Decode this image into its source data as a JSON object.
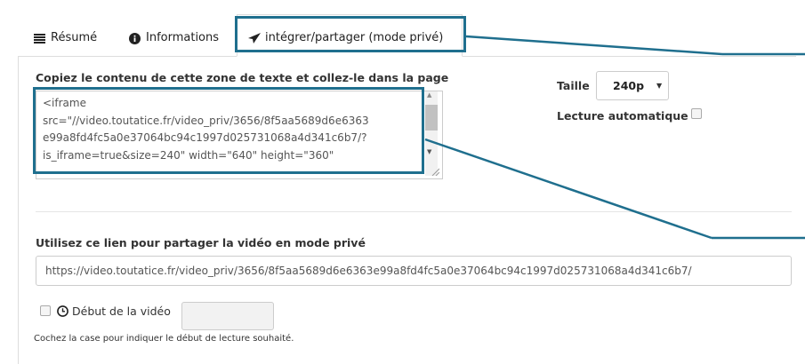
{
  "tabs": {
    "resume": "Résumé",
    "informations": "Informations",
    "share": "intégrer/partager (mode privé)"
  },
  "embed": {
    "label": "Copiez le contenu de cette zone de texte et collez-le dans la page",
    "code_lines": [
      "<iframe",
      "src=\"//video.toutatice.fr/video_priv/3656/8f5aa5689d6e6363",
      "e99a8fd4fc5a0e37064bc94c1997d025731068a4d341c6b7/?",
      "is_iframe=true&size=240\" width=\"640\" height=\"360\""
    ]
  },
  "options": {
    "size_label": "Taille",
    "size_value": "240p",
    "autoplay_label": "Lecture automatique",
    "autoplay_checked": false
  },
  "share": {
    "label": "Utilisez ce lien pour partager la vidéo en mode privé",
    "link": "https://video.toutatice.fr/video_priv/3656/8f5aa5689d6e6363e99a8fd4fc5a0e37064bc94c1997d025731068a4d341c6b7/"
  },
  "start": {
    "label": "Début de la vidéo",
    "checked": false,
    "value": "",
    "hint": "Cochez la case pour indiquer le début de lecture souhaité."
  },
  "colors": {
    "highlight": "#1f6f8e"
  }
}
